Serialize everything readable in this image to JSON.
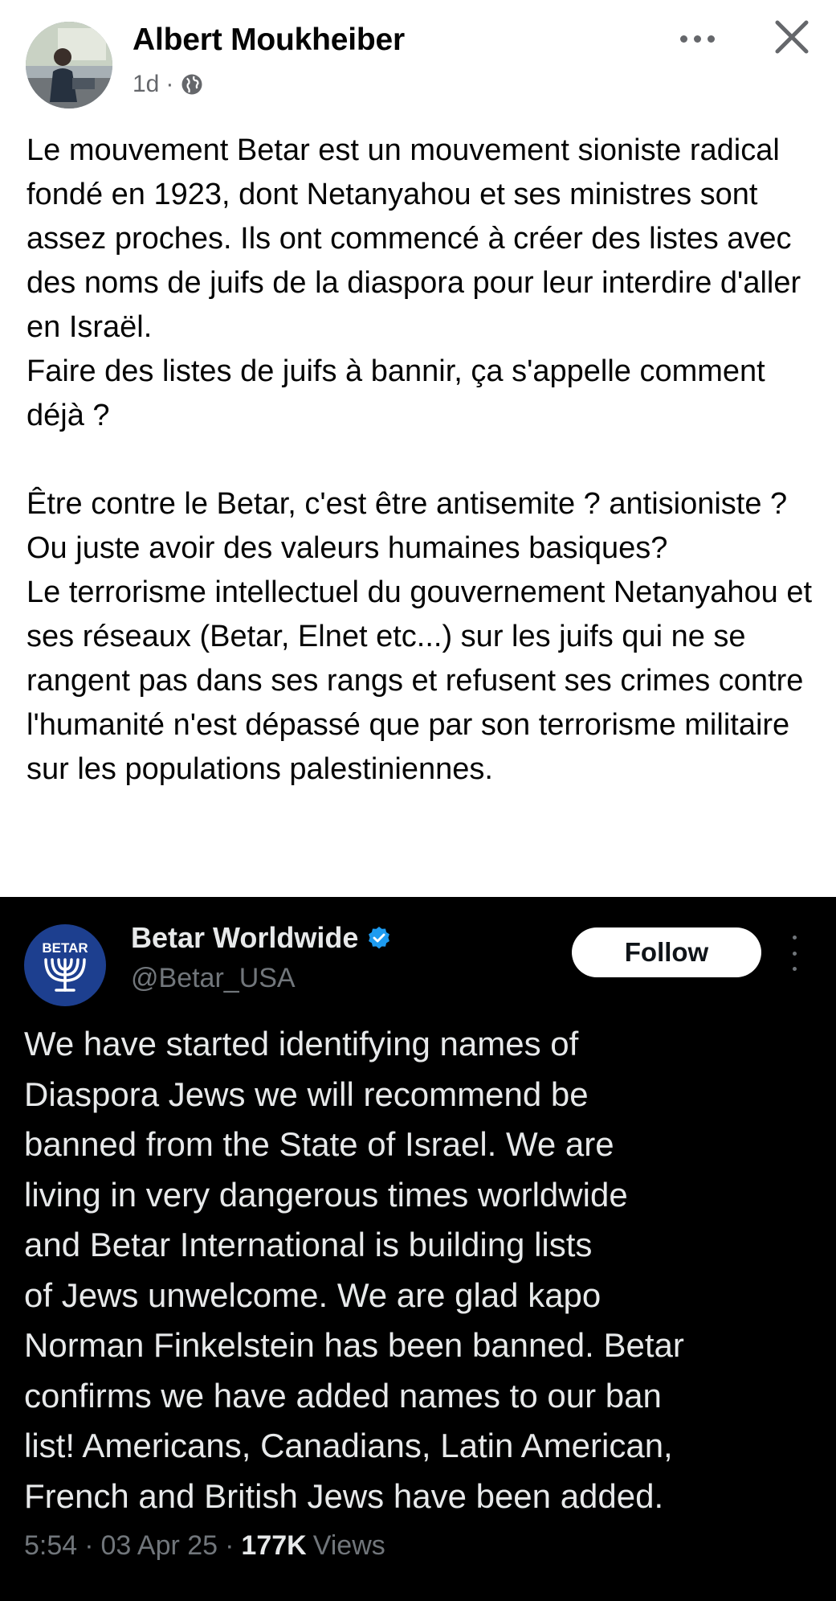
{
  "post": {
    "author": "Albert Moukheiber",
    "time": "1d",
    "separator": "·",
    "audience_icon": "globe-icon",
    "more_icon": "more-dots-icon",
    "close_icon": "close-icon",
    "paragraphs": [
      "Le mouvement Betar est un mouvement sioniste radical fondé en 1923, dont Netanyahou et ses ministres sont assez proches. Ils ont commencé à créer des listes avec des noms de juifs de la diaspora pour leur interdire d'aller en Israël.\nFaire des listes de juifs à bannir, ça s'appelle comment déjà ?",
      "Être contre le Betar, c'est être antisemite ? antisioniste ? Ou juste avoir des valeurs humaines basiques?\nLe terrorisme intellectuel du gouvernement Netanyahou et ses réseaux (Betar, Elnet etc...) sur les juifs qui ne se rangent pas dans ses rangs et refusent ses crimes contre l'humanité n'est dépassé que par son terrorisme militaire sur les populations palestiniennes."
    ]
  },
  "tweet": {
    "avatar_text": "BETAR",
    "name": "Betar Worldwide",
    "verified_icon": "verified-badge-icon",
    "handle": "@Betar_USA",
    "follow_label": "Follow",
    "text": "We have started identifying names of\nDiaspora Jews we will recommend be\nbanned from the State of Israel. We are\nliving in very dangerous times worldwide\nand Betar International is building lists\nof Jews unwelcome. We are glad kapo\nNorman Finkelstein has been banned. Betar\nconfirms we have added names to our ban\nlist! Americans, Canadians, Latin American,\nFrench and British Jews have been added.",
    "time": "5:54",
    "date": "03 Apr 25",
    "separator": "·",
    "views_count": "177K",
    "views_label": "Views"
  },
  "colors": {
    "text_primary": "#050505",
    "text_secondary": "#65676b",
    "tweet_background": "#000000",
    "tweet_text": "#e7e9ea",
    "tweet_muted": "#71767b",
    "verified_blue": "#1d9bf0",
    "betar_blue": "#1d3f8f"
  }
}
